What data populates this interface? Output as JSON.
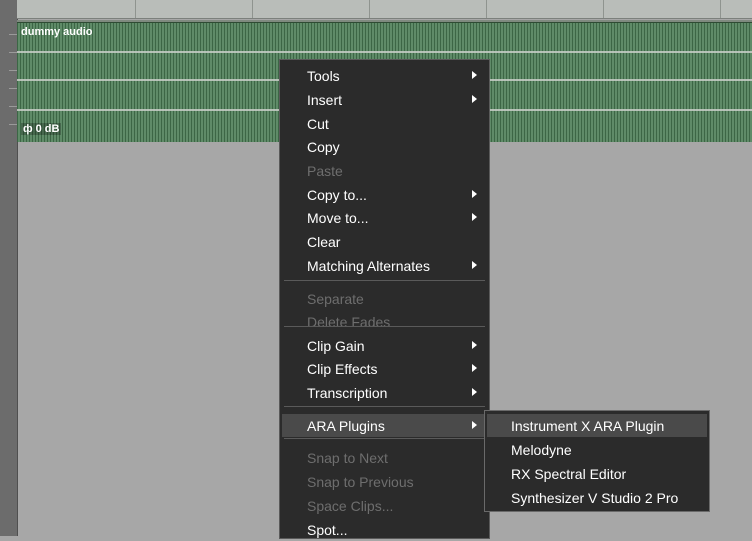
{
  "clip": {
    "name": "dummy audio",
    "gain": "0 dB",
    "gain_icon": "ф"
  },
  "menu": {
    "items": [
      {
        "label": "Tools",
        "disabled": false,
        "submenu": true
      },
      {
        "label": "Insert",
        "disabled": false,
        "submenu": true
      },
      {
        "label": "Cut",
        "disabled": false,
        "submenu": false
      },
      {
        "label": "Copy",
        "disabled": false,
        "submenu": false
      },
      {
        "label": "Paste",
        "disabled": true,
        "submenu": false
      },
      {
        "label": "Copy to...",
        "disabled": false,
        "submenu": true
      },
      {
        "label": "Move to...",
        "disabled": false,
        "submenu": true
      },
      {
        "label": "Clear",
        "disabled": false,
        "submenu": false
      },
      {
        "label": "Matching Alternates",
        "disabled": false,
        "submenu": true
      },
      {
        "label": "Separate",
        "disabled": true,
        "submenu": false
      },
      {
        "label": "Delete Fades",
        "disabled": true,
        "submenu": false
      },
      {
        "label": "Clip Gain",
        "disabled": false,
        "submenu": true
      },
      {
        "label": "Clip Effects",
        "disabled": false,
        "submenu": true
      },
      {
        "label": "Transcription",
        "disabled": false,
        "submenu": true
      },
      {
        "label": "ARA Plugins",
        "disabled": false,
        "submenu": true
      },
      {
        "label": "Snap to Next",
        "disabled": true,
        "submenu": false
      },
      {
        "label": "Snap to Previous",
        "disabled": true,
        "submenu": false
      },
      {
        "label": "Space Clips...",
        "disabled": true,
        "submenu": false
      },
      {
        "label": "Spot...",
        "disabled": false,
        "submenu": false
      }
    ]
  },
  "ara_submenu": {
    "items": [
      {
        "label": "Instrument X ARA Plugin"
      },
      {
        "label": "Melodyne"
      },
      {
        "label": "RX Spectral Editor"
      },
      {
        "label": "Synthesizer V Studio 2 Pro"
      }
    ]
  },
  "colors": {
    "menu_bg": "#2b2b2b",
    "menu_hover": "#4a4a4a",
    "disabled_text": "#6e6e6e",
    "clip_green": "#3c6645"
  }
}
